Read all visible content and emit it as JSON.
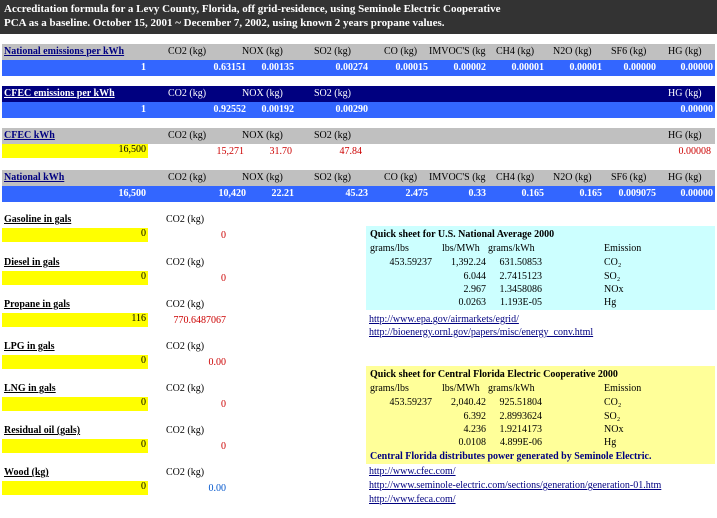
{
  "header": {
    "line1": "Accreditation formula for a Levy County, Florida, off grid-residence, using Seminole Electric Cooperative",
    "line2": "PCA as a baseline.     October 15, 2001 ~ December 7, 2002, using known 2 years propane values."
  },
  "national_per_kwh": {
    "label": "National emissions per kWh",
    "headers": [
      "CO2 (kg)",
      "NOX (kg)",
      "SO2 (kg)",
      "CO (kg)",
      "IMVOC'S (kg",
      "CH4 (kg)",
      "N2O (kg)",
      "SF6 (kg)",
      "HG (kg)"
    ],
    "kwh": "1",
    "values": [
      "0.63151",
      "0.00135",
      "0.00274",
      "0.00015",
      "0.00002",
      "0.00001",
      "0.00001",
      "0.00000",
      "0.00000"
    ]
  },
  "cfec_per_kwh": {
    "label": "CFEC emissions per kWh",
    "headers": [
      "CO2 (kg)",
      "NOX (kg)",
      "SO2 (kg)",
      "HG (kg)"
    ],
    "kwh": "1",
    "values": [
      "0.92552",
      "0.00192",
      "0.00290",
      "0.00000"
    ]
  },
  "cfec_kwh": {
    "label": "CFEC kWh",
    "headers": [
      "CO2 (kg)",
      "NOX (kg)",
      "SO2 (kg)",
      "HG (kg)"
    ],
    "kwh": "16,500",
    "values": [
      "15,271",
      "31.70",
      "47.84",
      "0.00008"
    ]
  },
  "national_kwh": {
    "label": "National kWh",
    "headers": [
      "CO2 (kg)",
      "NOX (kg)",
      "SO2 (kg)",
      "CO (kg)",
      "IMVOC'S (kg",
      "CH4 (kg)",
      "N2O (kg)",
      "SF6 (kg)",
      "HG (kg)"
    ],
    "kwh": "16,500",
    "values": [
      "10,420",
      "22.21",
      "45.23",
      "2.475",
      "0.33",
      "0.165",
      "0.165",
      "0.009075",
      "0.00000"
    ]
  },
  "fuels": [
    {
      "label": "Gasoline in gals",
      "unit": "CO2 (kg)",
      "amount": "0",
      "co2": "0"
    },
    {
      "label": "Diesel in gals",
      "unit": "CO2 (kg)",
      "amount": "0",
      "co2": "0"
    },
    {
      "label": "Propane in gals",
      "unit": "CO2 (kg)",
      "amount": "116",
      "co2": "770.6487067"
    },
    {
      "label": "LPG in gals",
      "unit": "CO2 (kg)",
      "amount": "0",
      "co2": "0.00"
    },
    {
      "label": "LNG in gals",
      "unit": "CO2 (kg)",
      "amount": "0",
      "co2": "0"
    },
    {
      "label": "Residual oil (gals)",
      "unit": "CO2 (kg)",
      "amount": "0",
      "co2": "0"
    },
    {
      "label": "Wood (kg)",
      "unit": "CO2 (kg)",
      "amount": "0",
      "co2": "0.00"
    }
  ],
  "qs_national": {
    "title": "Quick sheet for U.S. National Average 2000",
    "col1": "grams/lbs",
    "col2": "lbs/MWh",
    "col3": "grams/kWh",
    "col4": "Emission",
    "grams_lbs": "453.59237",
    "rows": [
      {
        "lbs": "1,392.24",
        "gkwh": "631.50853",
        "em": "CO₂"
      },
      {
        "lbs": "6.044",
        "gkwh": "2.7415123",
        "em": "SO₂"
      },
      {
        "lbs": "2.967",
        "gkwh": "1.3458086",
        "em": "NOx"
      },
      {
        "lbs": "0.0263",
        "gkwh": "1.193E-05",
        "em": "Hg"
      }
    ]
  },
  "links_national": [
    "http://www.epa.gov/airmarkets/egrid/",
    "http://bioenergy.ornl.gov/papers/misc/energy_conv.html"
  ],
  "qs_cfec": {
    "title": "Quick sheet for Central Florida Electric Cooperative 2000",
    "col1": "grams/lbs",
    "col2": "lbs/MWh",
    "col3": "grams/kWh",
    "col4": "Emission",
    "grams_lbs": "453.59237",
    "rows": [
      {
        "lbs": "2,040.42",
        "gkwh": "925.51804",
        "em": "CO₂"
      },
      {
        "lbs": "6.392",
        "gkwh": "2.8993624",
        "em": "SO₂"
      },
      {
        "lbs": "4.236",
        "gkwh": "1.9214173",
        "em": "NOx"
      },
      {
        "lbs": "0.0108",
        "gkwh": "4.899E-06",
        "em": "Hg"
      }
    ],
    "note": "Central Florida distributes power generated by Seminole Electric."
  },
  "links_cfec": [
    "http://www.cfec.com/",
    "http://www.seminole-electric.com/sections/generation/generation-01.htm",
    "http://www.feca.com/"
  ],
  "colors": {
    "header_bg": "#333333",
    "navy": "#000080",
    "blue": "#3366ff",
    "gray": "#c0c0c0",
    "yellow": "#ffff00",
    "cyan": "#ccffff",
    "light_yellow": "#ffff99"
  }
}
